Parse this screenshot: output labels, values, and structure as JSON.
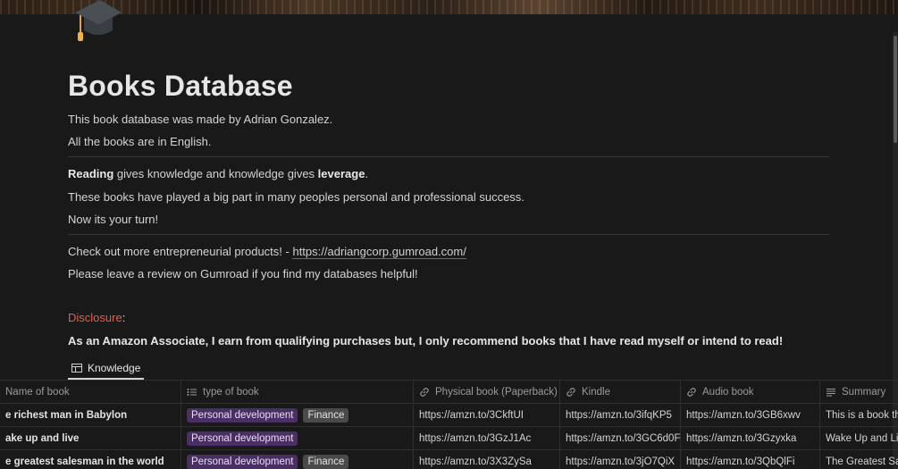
{
  "page": {
    "title": "Books Database",
    "intro_line1": "This book database was made by Adrian Gonzalez.",
    "intro_line2": "All the books are in English.",
    "reading_bold": "Reading",
    "reading_mid": " gives knowledge and knowledge gives ",
    "leverage_bold": "leverage",
    "reading_end": ".",
    "success_line": "These books have played a big part in many peoples personal and professional success.",
    "turn_line": "Now its your turn!",
    "check_out_prefix": "Check out more entrepreneurial products! - ",
    "check_out_link": "https://adriangcorp.gumroad.com/",
    "review_line": "Please leave a review on Gumroad if you find my databases helpful!",
    "disclosure_label": "Disclosure",
    "disclosure_colon": ":",
    "disclosure_text": "As an Amazon Associate, I earn from qualifying purchases but, I only recommend books that I have read myself or intend to read!"
  },
  "icons": {
    "page_icon": "graduation-cap-icon",
    "tab_icon": "table-icon"
  },
  "colors": {
    "background": "#191919",
    "disclosure": "#e0604d",
    "tag_personal_development": "#492f64",
    "tag_finance": "#4a4a4a"
  },
  "database": {
    "tab_label": "Knowledge",
    "columns": [
      {
        "label": "Name of book",
        "icon": "text-icon"
      },
      {
        "label": "type of book",
        "icon": "list-icon"
      },
      {
        "label": "Physical book (Paperback)",
        "icon": "link-icon"
      },
      {
        "label": "Kindle",
        "icon": "link-icon"
      },
      {
        "label": "Audio book",
        "icon": "link-icon"
      },
      {
        "label": "Summary",
        "icon": "text-lines-icon"
      }
    ],
    "rows": [
      {
        "name": "e richest man in Babylon",
        "tags": [
          "Personal development",
          "Finance"
        ],
        "paperback": "https://amzn.to/3CkftUI",
        "kindle": "https://amzn.to/3ifqKP5",
        "audio": "https://amzn.to/3GB6xwv",
        "summary": "This is a book th"
      },
      {
        "name": "ake up and live",
        "tags": [
          "Personal development"
        ],
        "paperback": "https://amzn.to/3GzJ1Ac",
        "kindle": "https://amzn.to/3GC6d0F",
        "audio": "https://amzn.to/3Gzyxka",
        "summary": "Wake Up and Liv"
      },
      {
        "name": "e greatest salesman in the world",
        "tags": [
          "Personal development",
          "Finance"
        ],
        "paperback": "https://amzn.to/3X3ZySa",
        "kindle": "https://amzn.to/3jO7QiX",
        "audio": "https://amzn.to/3QbQlFi",
        "summary": "The Greatest Sal"
      }
    ]
  }
}
